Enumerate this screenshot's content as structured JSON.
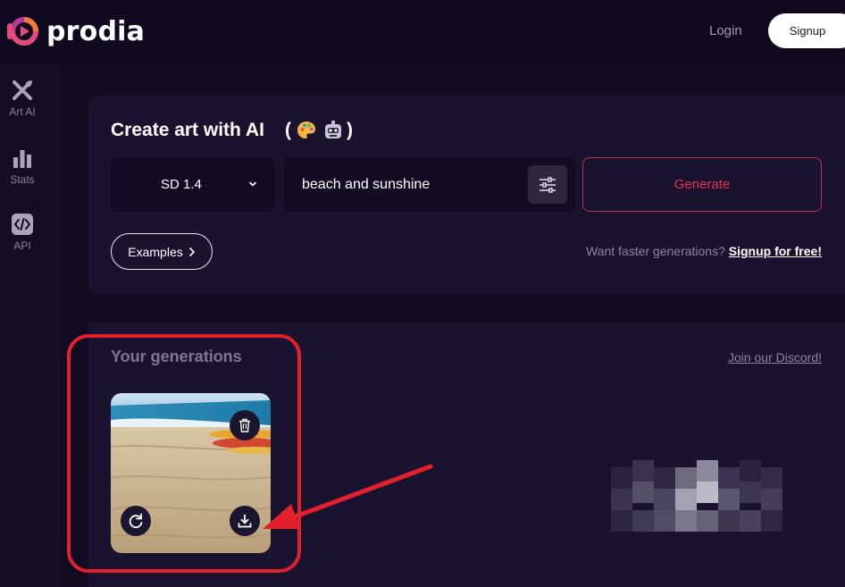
{
  "app": {
    "brand": "prodia",
    "login_label": "Login",
    "signup_label": "Signup"
  },
  "sidebar": {
    "items": [
      {
        "label": "Art AI",
        "icon": "art-ai-icon"
      },
      {
        "label": "Stats",
        "icon": "stats-bar-icon"
      },
      {
        "label": "API",
        "icon": "code-icon"
      }
    ]
  },
  "create": {
    "title": "Create art with AI",
    "emojis": [
      "palette-emoji",
      "robot-emoji"
    ],
    "model_value": "SD 1.4",
    "prompt_value": "beach and sunshine",
    "generate_label": "Generate",
    "examples_label": "Examples",
    "faster_text": "Want faster generations?",
    "faster_link": "Signup for free!"
  },
  "generations": {
    "title": "Your generations",
    "discord_link": "Join our Discord!",
    "items": [
      {
        "description": "beach and sunshine",
        "actions": [
          "delete-icon",
          "regenerate-icon",
          "download-icon"
        ]
      }
    ]
  },
  "colors": {
    "background": "#110c22",
    "card": "#1a1330",
    "accent": "#e63350",
    "annotation": "#e3202c"
  }
}
